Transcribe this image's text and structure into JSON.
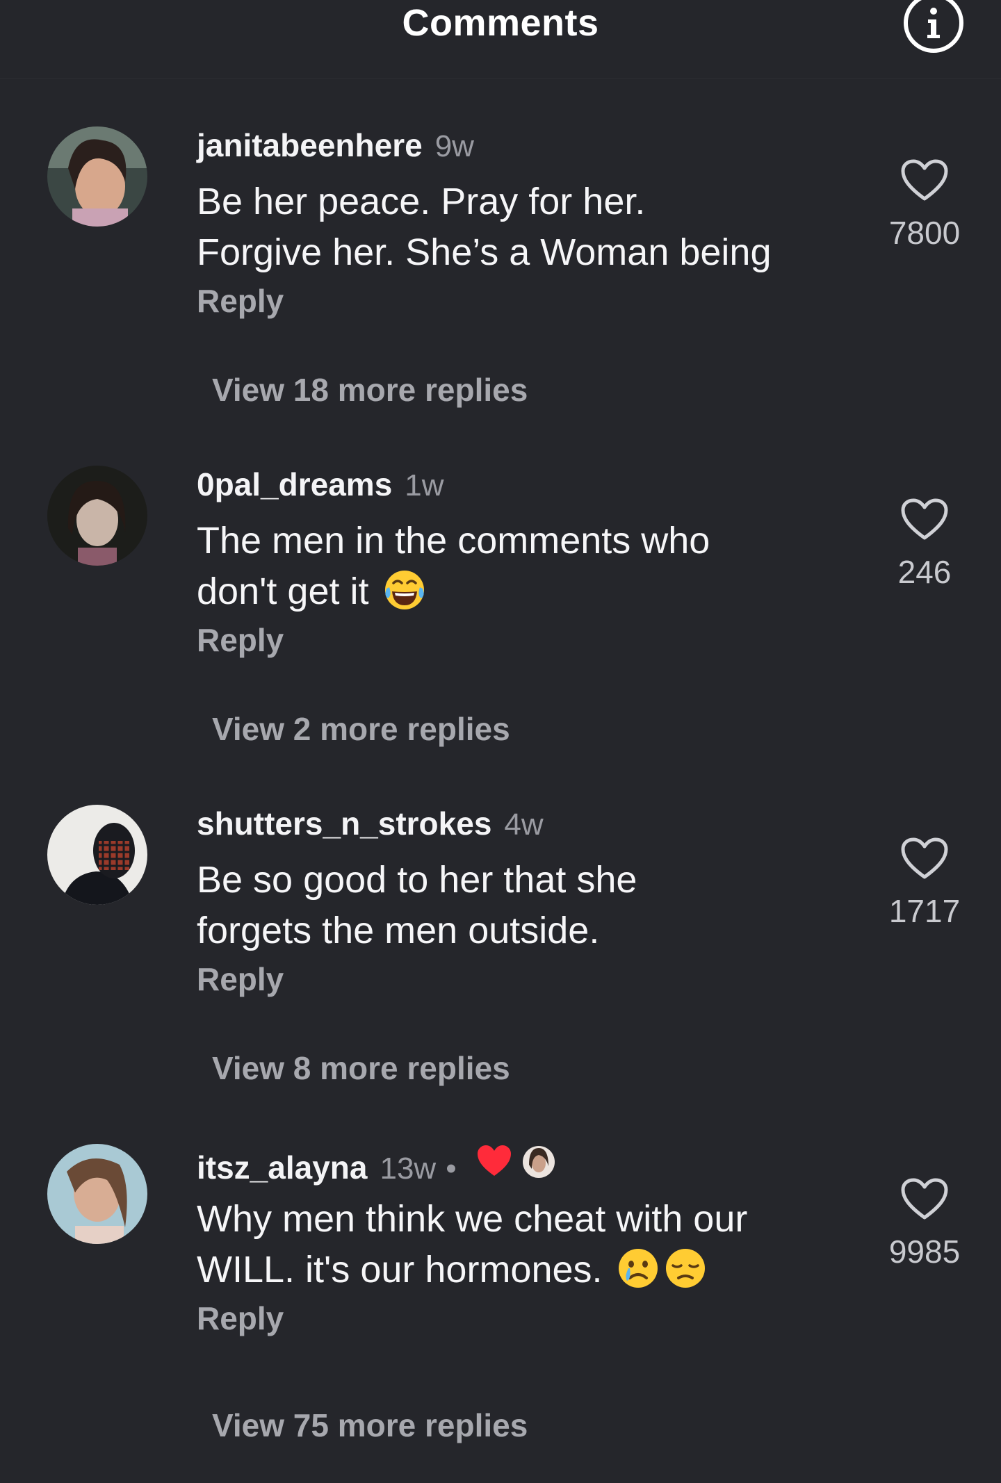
{
  "header": {
    "title": "Comments",
    "info_icon": "info-icon"
  },
  "comments": [
    {
      "username": "janitabeenhere",
      "time": "9w",
      "lines": [
        "Be her peace. Pray for her.",
        "Forgive her. She’s a Woman being"
      ],
      "reply_label": "Reply",
      "view_more": "View 18 more replies",
      "likes": "7800"
    },
    {
      "username": "0pal_dreams",
      "time": "1w",
      "lines": [
        "The men in the comments who",
        "don't get it"
      ],
      "emojis": [
        "face-with-tears-of-joy"
      ],
      "reply_label": "Reply",
      "view_more": "View 2 more replies",
      "likes": "246"
    },
    {
      "username": "shutters_n_strokes",
      "time": "4w",
      "lines": [
        "Be so good to her that she",
        "forgets the men outside."
      ],
      "reply_label": "Reply",
      "view_more": "View 8 more replies",
      "likes": "1717"
    },
    {
      "username": "itsz_alayna",
      "time": "13w",
      "separator": "•",
      "creator_liked": true,
      "lines": [
        "Why men think we cheat with our",
        "WILL. it's our hormones."
      ],
      "emojis": [
        "crying-face",
        "disappointed-face"
      ],
      "reply_label": "Reply",
      "view_more": "View 75 more replies",
      "likes": "9985"
    }
  ],
  "colors": {
    "background": "#25262b",
    "text_primary": "#f6f6f8",
    "text_secondary": "#a7a8ae",
    "heart_red": "#ff2b3a"
  }
}
